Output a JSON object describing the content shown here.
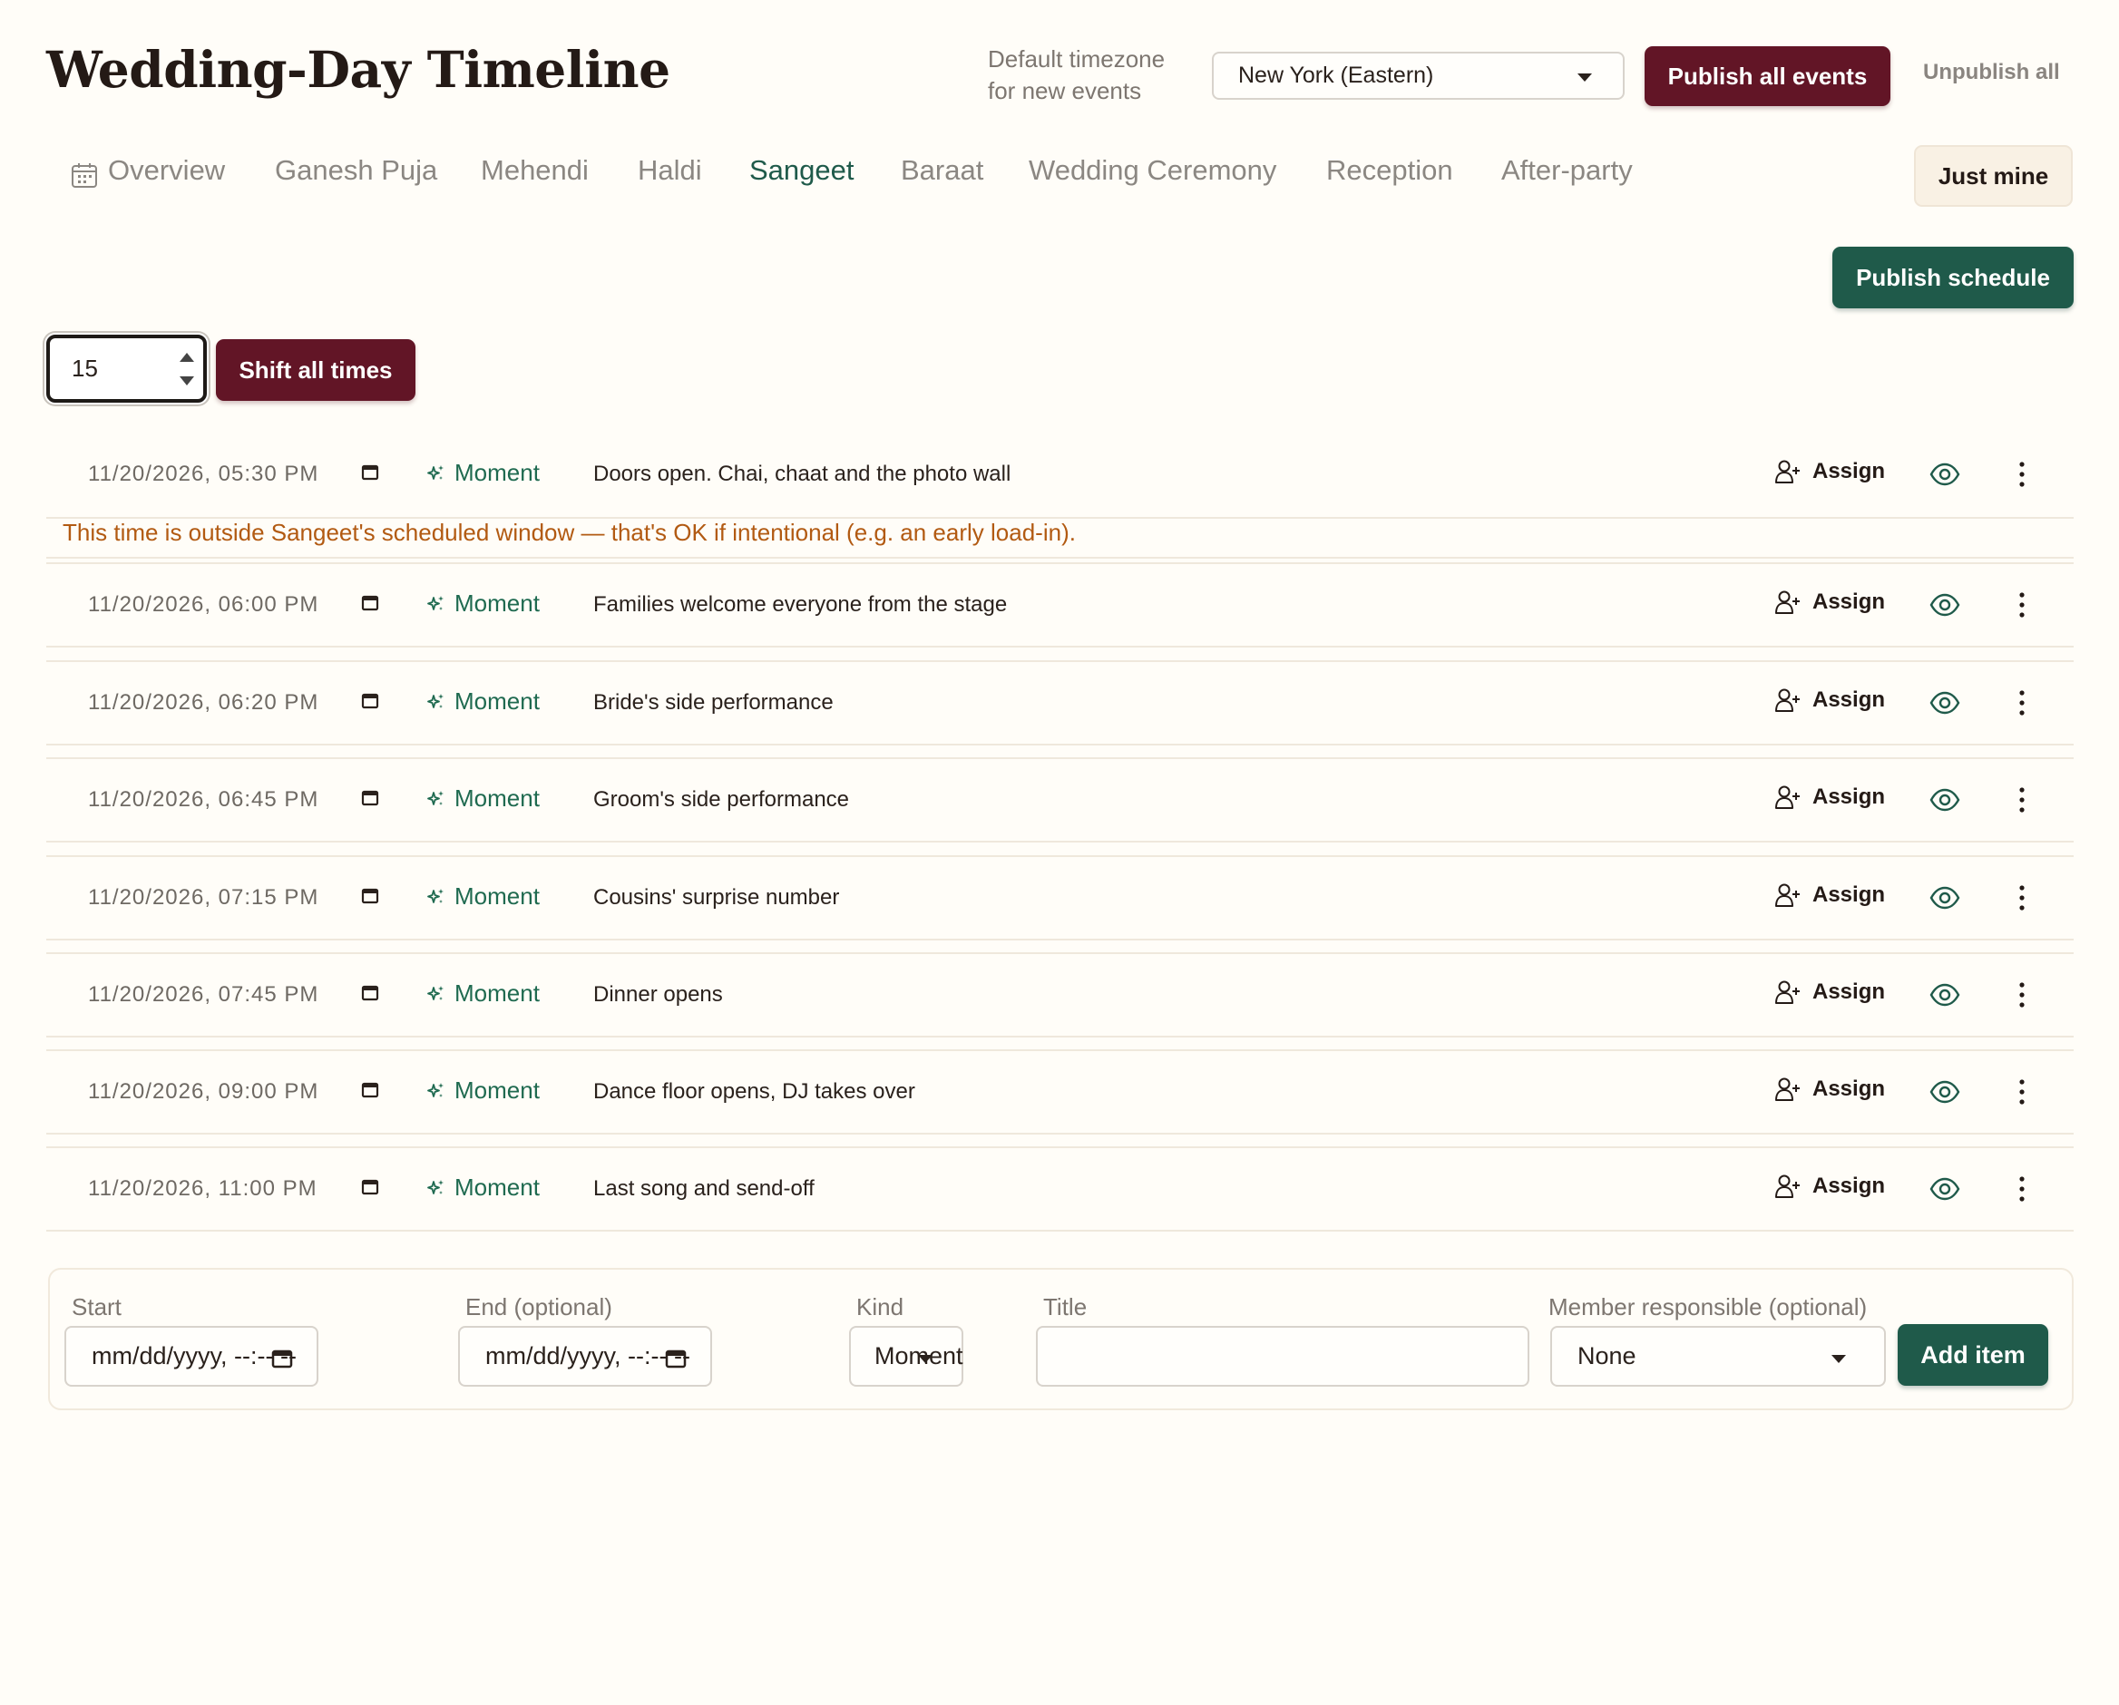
{
  "header": {
    "title": "Wedding-Day Timeline",
    "timezone_label": "Default timezone for new events",
    "timezone_value": "New York (Eastern)",
    "publish_all_label": "Publish all events",
    "unpublish_all_label": "Unpublish all"
  },
  "tabs": [
    {
      "label": "Overview",
      "active": false
    },
    {
      "label": "Ganesh Puja",
      "active": false
    },
    {
      "label": "Mehendi",
      "active": false
    },
    {
      "label": "Haldi",
      "active": false
    },
    {
      "label": "Sangeet",
      "active": true
    },
    {
      "label": "Baraat",
      "active": false
    },
    {
      "label": "Wedding Ceremony",
      "active": false
    },
    {
      "label": "Reception",
      "active": false
    },
    {
      "label": "After-party",
      "active": false
    }
  ],
  "toolbar": {
    "just_mine_label": "Just mine",
    "publish_schedule_label": "Publish schedule",
    "shift_value": "15",
    "shift_label": "Shift all times"
  },
  "warning": "This time is outside Sangeet's scheduled window — that's OK if intentional (e.g. an early load-in).",
  "items": [
    {
      "when": "11/20/2026, 05:30 PM",
      "kind": "Moment",
      "title": "Doors open. Chai, chaat and the photo wall",
      "assign": "Assign"
    },
    {
      "when": "11/20/2026, 06:00 PM",
      "kind": "Moment",
      "title": "Families welcome everyone from the stage",
      "assign": "Assign"
    },
    {
      "when": "11/20/2026, 06:20 PM",
      "kind": "Moment",
      "title": "Bride's side performance",
      "assign": "Assign"
    },
    {
      "when": "11/20/2026, 06:45 PM",
      "kind": "Moment",
      "title": "Groom's side performance",
      "assign": "Assign"
    },
    {
      "when": "11/20/2026, 07:15 PM",
      "kind": "Moment",
      "title": "Cousins' surprise number",
      "assign": "Assign"
    },
    {
      "when": "11/20/2026, 07:45 PM",
      "kind": "Moment",
      "title": "Dinner opens",
      "assign": "Assign"
    },
    {
      "when": "11/20/2026, 09:00 PM",
      "kind": "Moment",
      "title": "Dance floor opens, DJ takes over",
      "assign": "Assign"
    },
    {
      "when": "11/20/2026, 11:00 PM",
      "kind": "Moment",
      "title": "Last song and send-off",
      "assign": "Assign"
    }
  ],
  "add_form": {
    "start_label": "Start",
    "start_placeholder": "mm/dd/yyyy, --:-- --",
    "end_label": "End (optional)",
    "end_placeholder": "mm/dd/yyyy, --:-- --",
    "kind_label": "Kind",
    "kind_value": "Moment",
    "title_label": "Title",
    "title_value": "",
    "member_label": "Member responsible (optional)",
    "member_value": "None",
    "add_label": "Add item"
  },
  "colors": {
    "maroon": "#621526",
    "green": "#1f5a4a",
    "warning": "#b25a12",
    "background": "#fffdf8"
  }
}
